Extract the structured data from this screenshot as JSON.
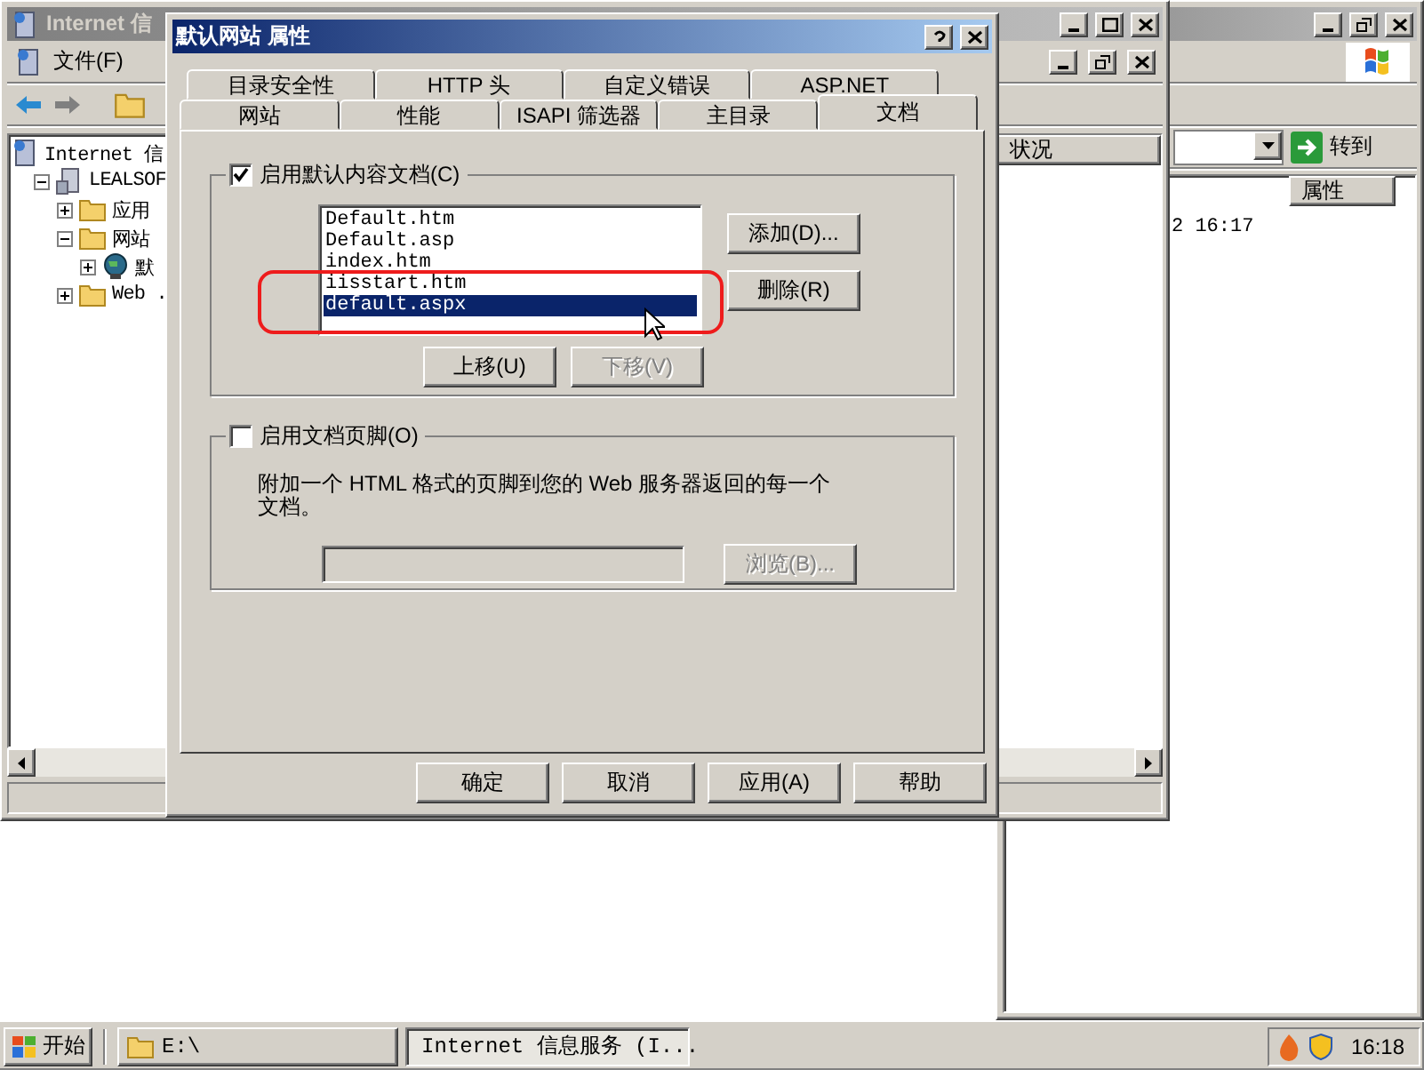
{
  "iis_window": {
    "title": "Internet 信",
    "menu": [
      "文件(F)"
    ],
    "tree": [
      {
        "label": "Internet 信",
        "kind": "root",
        "children": [
          {
            "label": "LEALSOF",
            "kind": "server",
            "expanded": true,
            "children": [
              {
                "label": "应用",
                "kind": "folder",
                "expanded": false
              },
              {
                "label": "网站",
                "kind": "folder",
                "expanded": true,
                "children": [
                  {
                    "label": "默",
                    "kind": "site",
                    "expanded": false
                  }
                ]
              },
              {
                "label": "Web .",
                "kind": "folder",
                "expanded": false
              }
            ]
          }
        ]
      }
    ],
    "column_header": "状况"
  },
  "explorer_window": {
    "go_button": "转到",
    "column_header": "属性",
    "row_text": "2 16:17"
  },
  "dialog": {
    "title": "默认网站 属性",
    "tab_rows": [
      [
        {
          "label": "目录安全性",
          "selected": false
        },
        {
          "label": "HTTP 头",
          "selected": false
        },
        {
          "label": "自定义错误",
          "selected": false
        },
        {
          "label": "ASP.NET",
          "selected": false
        }
      ],
      [
        {
          "label": "网站",
          "selected": false
        },
        {
          "label": "性能",
          "selected": false
        },
        {
          "label": "ISAPI 筛选器",
          "selected": false
        },
        {
          "label": "主目录",
          "selected": false
        },
        {
          "label": "文档",
          "selected": true
        }
      ]
    ],
    "default_docs": {
      "label": "启用默认内容文档(C)",
      "checked": true,
      "items": [
        {
          "label": "Default.htm",
          "selected": false
        },
        {
          "label": "Default.asp",
          "selected": false
        },
        {
          "label": "index.htm",
          "selected": false
        },
        {
          "label": "iisstart.htm",
          "selected": false
        },
        {
          "label": "default.aspx",
          "selected": true
        }
      ],
      "side_buttons": [
        {
          "label": "添加(D)...",
          "disabled": false
        },
        {
          "label": "删除(R)",
          "disabled": false
        }
      ],
      "move_buttons": [
        {
          "label": "上移(U)",
          "disabled": false
        },
        {
          "label": "下移(V)",
          "disabled": true
        }
      ]
    },
    "footer": {
      "label": "启用文档页脚(O)",
      "checked": false,
      "description": "附加一个 HTML 格式的页脚到您的 Web 服务器返回的每一个文档。",
      "browse_button": {
        "label": "浏览(B)...",
        "disabled": true
      }
    },
    "buttons": [
      "确定",
      "取消",
      "应用(A)",
      "帮助"
    ]
  },
  "taskbar": {
    "start": "开始",
    "tasks": [
      {
        "label": "E:\\",
        "kind": "folder",
        "selected": false
      },
      {
        "label": "Internet 信息服务 (I...",
        "kind": "iis",
        "selected": true
      }
    ],
    "clock": "16:18"
  }
}
